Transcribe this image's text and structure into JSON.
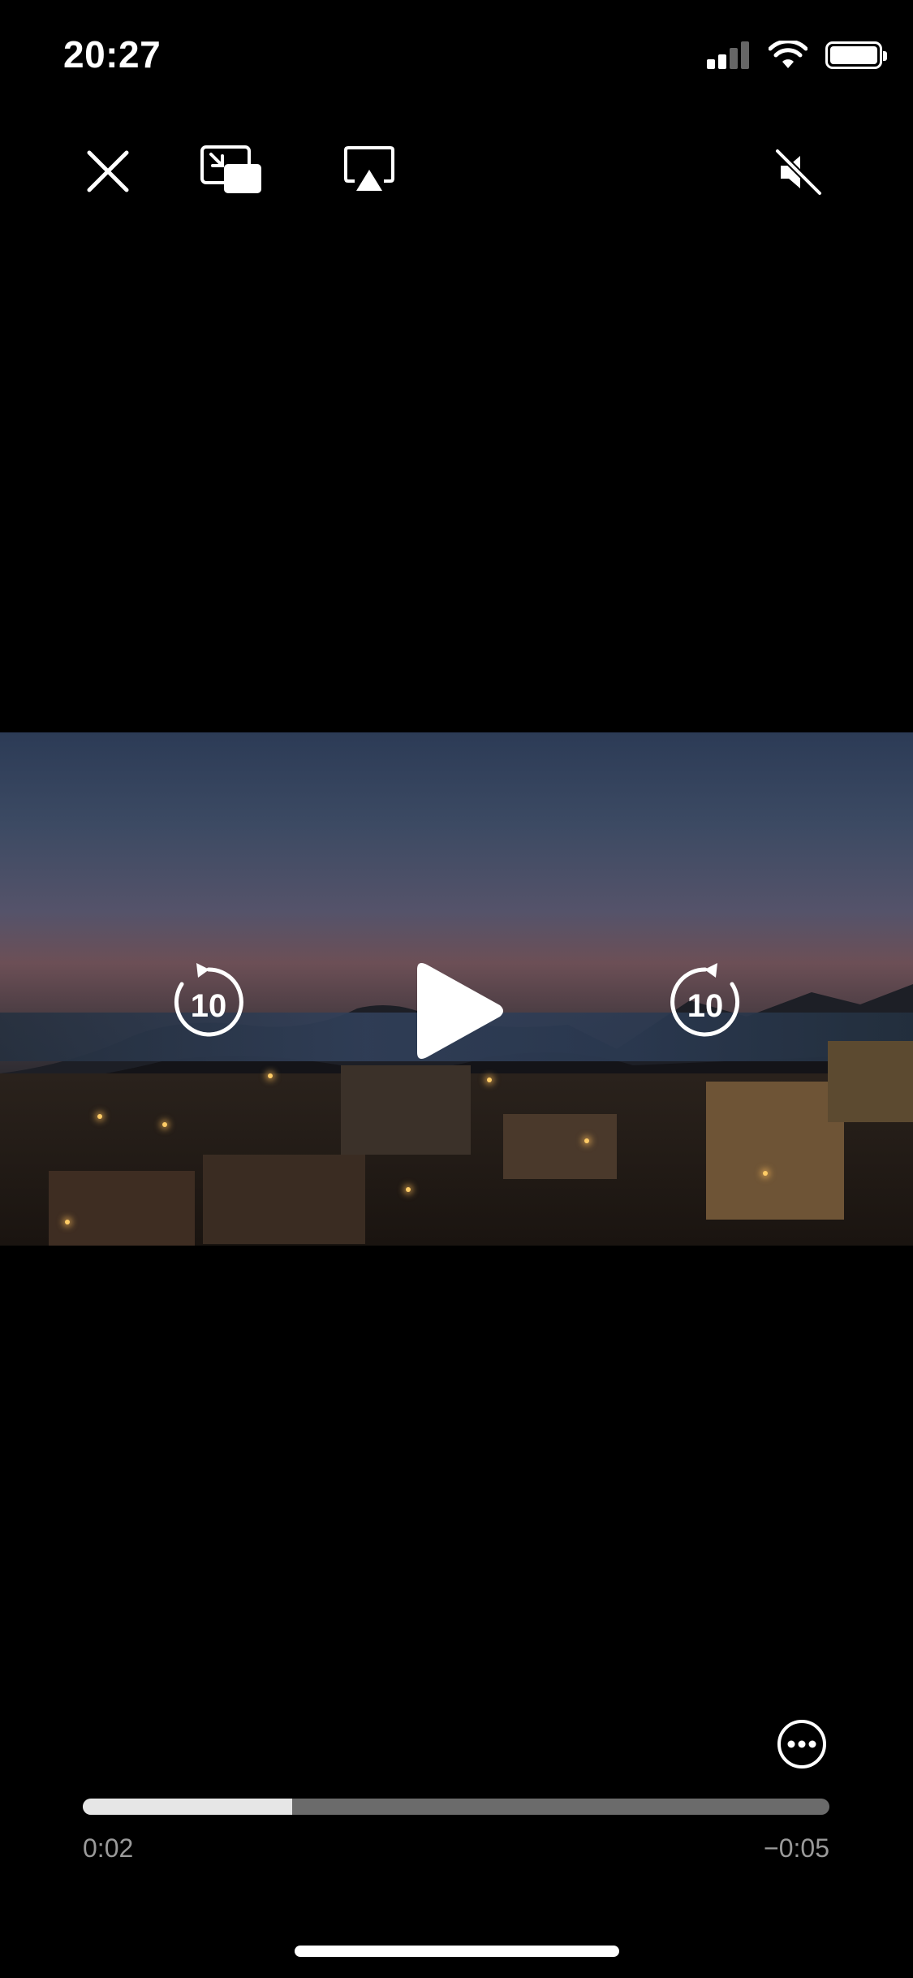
{
  "status": {
    "time": "20:27",
    "icons": [
      "signal-icon",
      "wifi-icon",
      "battery-icon"
    ]
  },
  "top_controls": {
    "icons": [
      "close-icon",
      "picture-in-picture-icon",
      "airplay-icon",
      "muted-speaker-icon"
    ]
  },
  "player": {
    "skip_back_seconds": "10",
    "skip_forward_seconds": "10",
    "center_icon": "play-icon",
    "more_icon": "more-options-icon",
    "progress_fraction": 0.28,
    "elapsed": "0:02",
    "remaining": "−0:05"
  },
  "colors": {
    "background": "#000000",
    "progress_played": "#e6e6e6",
    "progress_track": "#6b6b6b",
    "time_text": "#9a9a9a"
  }
}
